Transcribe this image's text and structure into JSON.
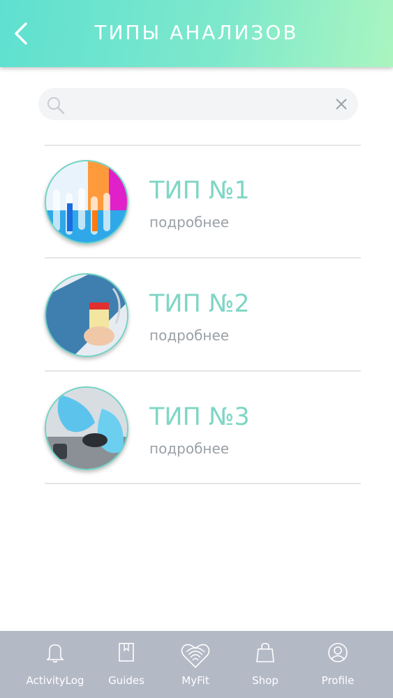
{
  "header": {
    "title": "ТИПЫ АНАЛИЗОВ",
    "back_icon": "chevron-left-icon"
  },
  "search": {
    "value": "",
    "placeholder": ""
  },
  "items": [
    {
      "title": "ТИП №1",
      "subtitle": "подробнее",
      "image": "test-tubes-photo"
    },
    {
      "title": "ТИП №2",
      "subtitle": "подробнее",
      "image": "sample-container-photo"
    },
    {
      "title": "ТИП №3",
      "subtitle": "подробнее",
      "image": "lab-gloves-photo"
    }
  ],
  "tabbar": {
    "tabs": [
      {
        "label": "ActivityLog",
        "icon": "bell-icon"
      },
      {
        "label": "Guides",
        "icon": "book-icon"
      },
      {
        "label": "MyFit",
        "icon": "heart-fingerprint-icon"
      },
      {
        "label": "Shop",
        "icon": "bag-icon"
      },
      {
        "label": "Profile",
        "icon": "profile-icon"
      }
    ]
  },
  "colors": {
    "accent": "#7fd6c5",
    "header_start": "#5ee0d0",
    "header_end": "#aaf5c0",
    "tabbar": "#b4b9c6"
  }
}
